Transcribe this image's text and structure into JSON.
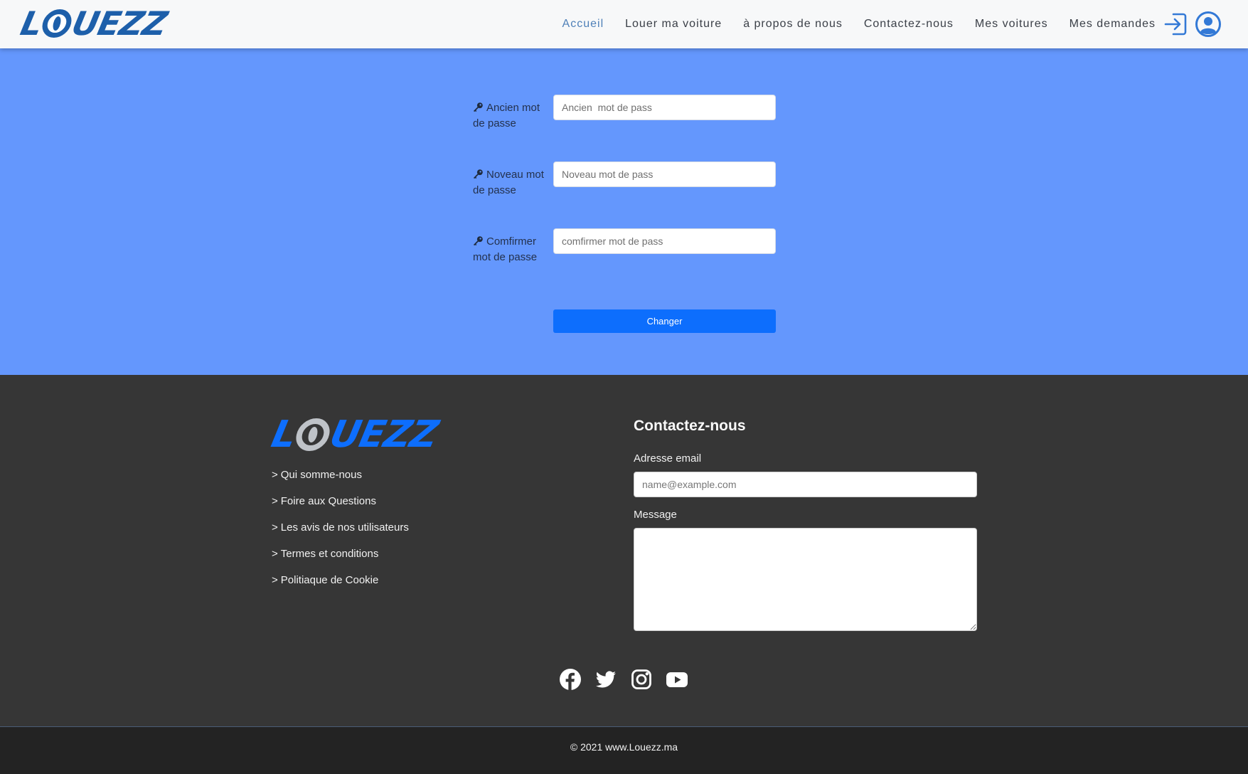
{
  "brand": {
    "logo_first": "L",
    "logo_rest": "UEZZ"
  },
  "nav": {
    "links": [
      {
        "label": "Accueil",
        "active": true
      },
      {
        "label": "Louer ma voiture"
      },
      {
        "label": "à propos de nous"
      },
      {
        "label": "Contactez-nous"
      },
      {
        "label": "Mes voitures"
      },
      {
        "label": "Mes demandes"
      }
    ],
    "icons": [
      "sign-in-icon",
      "user-circle-icon"
    ]
  },
  "password_form": {
    "fields": [
      {
        "label": "Ancien mot de passe",
        "placeholder": "Ancien  mot de pass",
        "value": ""
      },
      {
        "label": "Noveau mot de passe",
        "placeholder": "Noveau mot de pass",
        "value": ""
      },
      {
        "label": "Comfirmer mot de passe",
        "placeholder": "comfirmer mot de pass",
        "value": ""
      }
    ],
    "submit_label": "Changer",
    "icon": "key-icon"
  },
  "footer": {
    "links": [
      "Qui somme-nous",
      "Foire aux Questions",
      "Les avis de nos utilisateurs",
      "Termes et conditions",
      "Politiaque de Cookie"
    ],
    "arrow": ">",
    "contact": {
      "title": "Contactez-nous",
      "email_label": "Adresse email",
      "email_placeholder": "name@example.com",
      "message_label": "Message",
      "message_value": ""
    },
    "social_icons": [
      "facebook-icon",
      "twitter-icon",
      "instagram-icon",
      "youtube-icon"
    ],
    "copyright": "© 2021 www.Louezz.ma"
  },
  "colors": {
    "nav_bg": "#f7f8f9",
    "main_bg": "#6497fd",
    "footer_bg": "#363636",
    "bottom_bg": "#232323",
    "primary": "#0d6efd",
    "logo_blue": "#1d5faa"
  }
}
